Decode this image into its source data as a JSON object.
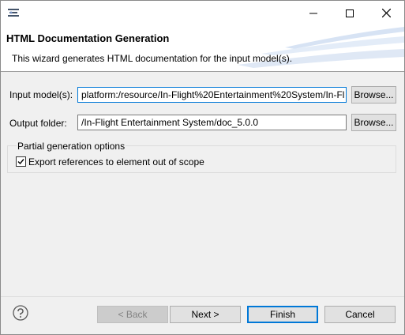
{
  "window": {
    "icon": "wizard-app-icon",
    "controls": {
      "minimize": "minimize-icon",
      "maximize": "maximize-icon",
      "close": "close-icon"
    }
  },
  "banner": {
    "title": "HTML Documentation Generation",
    "description": "This wizard generates HTML documentation for the input model(s)."
  },
  "form": {
    "input_label": "Input model(s):",
    "input_value": "platform:/resource/In-Flight%20Entertainment%20System/In-Fl",
    "output_label": "Output folder:",
    "output_value": "/In-Flight Entertainment System/doc_5.0.0",
    "browse_label": "Browse..."
  },
  "options": {
    "group_title": "Partial generation options",
    "export_label": "Export references to element out of scope",
    "export_checked": true
  },
  "footer": {
    "help_icon": "help-icon",
    "back_label": "< Back",
    "next_label": "Next >",
    "finish_label": "Finish",
    "cancel_label": "Cancel"
  },
  "colors": {
    "accent": "#0078d7",
    "banner_stripe": "#d7e3f4"
  }
}
